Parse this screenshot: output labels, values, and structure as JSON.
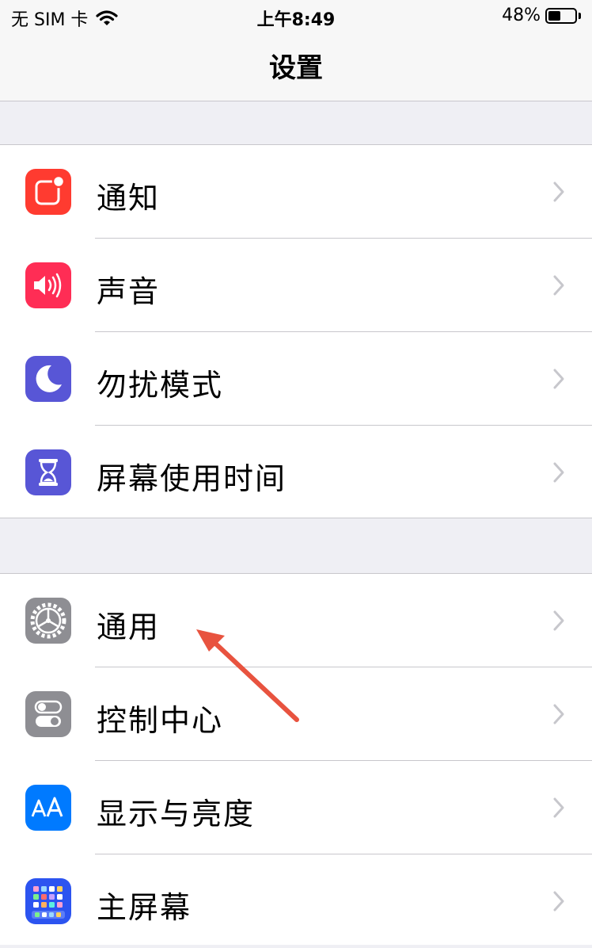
{
  "status_bar": {
    "carrier": "无 SIM 卡",
    "time": "上午8:49",
    "battery_percent_text": "48%",
    "battery_level": 0.48
  },
  "nav": {
    "title": "设置"
  },
  "groups": [
    {
      "items": [
        {
          "label": "通知",
          "icon": "notifications-icon",
          "color": "#ff3b30"
        },
        {
          "label": "声音",
          "icon": "sounds-icon",
          "color": "#ff2d55"
        },
        {
          "label": "勿扰模式",
          "icon": "moon-icon",
          "color": "#5856d6"
        },
        {
          "label": "屏幕使用时间",
          "icon": "hourglass-icon",
          "color": "#5856d6"
        }
      ]
    },
    {
      "items": [
        {
          "label": "通用",
          "icon": "gear-icon",
          "color": "#8e8e93"
        },
        {
          "label": "控制中心",
          "icon": "toggles-icon",
          "color": "#8e8e93"
        },
        {
          "label": "显示与亮度",
          "icon": "text-size-icon",
          "color": "#007aff"
        },
        {
          "label": "主屏幕",
          "icon": "home-screen-icon",
          "color": "#2c54f0"
        }
      ]
    }
  ],
  "annotation": {
    "color": "#e8533f"
  }
}
